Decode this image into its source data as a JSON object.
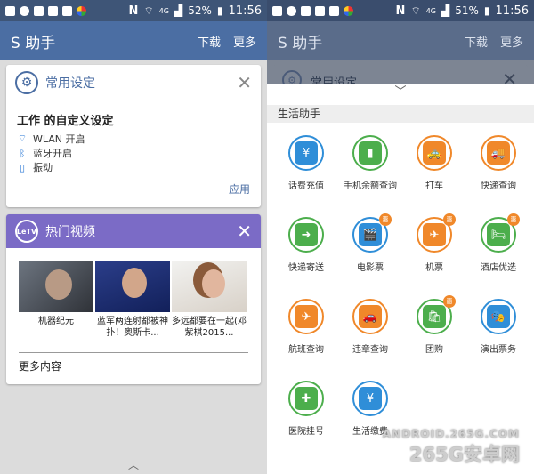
{
  "status_left": {
    "battery": "52%",
    "time": "11:56",
    "network": "4G",
    "n_icon": "N"
  },
  "status_right": {
    "battery": "51%",
    "time": "11:56",
    "network": "4G",
    "n_icon": "N"
  },
  "appbar": {
    "title": "S 助手",
    "download": "下载",
    "more": "更多"
  },
  "settings_card": {
    "title": "常用设定",
    "profile": "工作 的自定义设定",
    "items": [
      {
        "icon": "wifi-icon",
        "label": "WLAN 开启"
      },
      {
        "icon": "bluetooth-icon",
        "label": "蓝牙开启"
      },
      {
        "icon": "vibrate-icon",
        "label": "振动"
      }
    ],
    "apply": "应用"
  },
  "video_card": {
    "logo": "LeTV",
    "title": "热门视频",
    "videos": [
      {
        "caption": "机器纪元"
      },
      {
        "caption": "蓝军两连射都被神扑！奥斯卡..."
      },
      {
        "caption": "多远都要在一起(邓紫棋2015..."
      }
    ],
    "more": "更多内容"
  },
  "life_helper": {
    "section_title": "生活助手",
    "items": [
      {
        "label": "话费充值",
        "icon": "phone-recharge-icon",
        "color": "blue",
        "glyph": "¥",
        "badge": ""
      },
      {
        "label": "手机余额查询",
        "icon": "balance-query-icon",
        "color": "green",
        "glyph": "▮",
        "badge": ""
      },
      {
        "label": "打车",
        "icon": "taxi-icon",
        "color": "orange",
        "glyph": "🚕",
        "badge": ""
      },
      {
        "label": "快递查询",
        "icon": "express-query-icon",
        "color": "orange",
        "glyph": "🚚",
        "badge": ""
      },
      {
        "label": "快递寄送",
        "icon": "express-send-icon",
        "color": "green",
        "glyph": "➜",
        "badge": ""
      },
      {
        "label": "电影票",
        "icon": "movie-ticket-icon",
        "color": "blue",
        "glyph": "🎬",
        "badge": "惠"
      },
      {
        "label": "机票",
        "icon": "plane-ticket-icon",
        "color": "orange",
        "glyph": "✈",
        "badge": "惠"
      },
      {
        "label": "酒店优选",
        "icon": "hotel-icon",
        "color": "green",
        "glyph": "🛏",
        "badge": "惠"
      },
      {
        "label": "航班查询",
        "icon": "flight-query-icon",
        "color": "orange",
        "glyph": "✈",
        "badge": ""
      },
      {
        "label": "违章查询",
        "icon": "violation-query-icon",
        "color": "orange",
        "glyph": "🚗",
        "badge": ""
      },
      {
        "label": "团购",
        "icon": "group-buy-icon",
        "color": "green",
        "glyph": "🛍",
        "badge": "惠"
      },
      {
        "label": "演出票务",
        "icon": "show-ticket-icon",
        "color": "blue",
        "glyph": "🎭",
        "badge": ""
      },
      {
        "label": "医院挂号",
        "icon": "hospital-icon",
        "color": "green",
        "glyph": "✚",
        "badge": ""
      },
      {
        "label": "生活缴费",
        "icon": "utility-payment-icon",
        "color": "blue",
        "glyph": "¥",
        "badge": ""
      }
    ]
  },
  "watermark": {
    "line1": "ANDROID.265G.COM",
    "line2": "265G安卓网"
  }
}
